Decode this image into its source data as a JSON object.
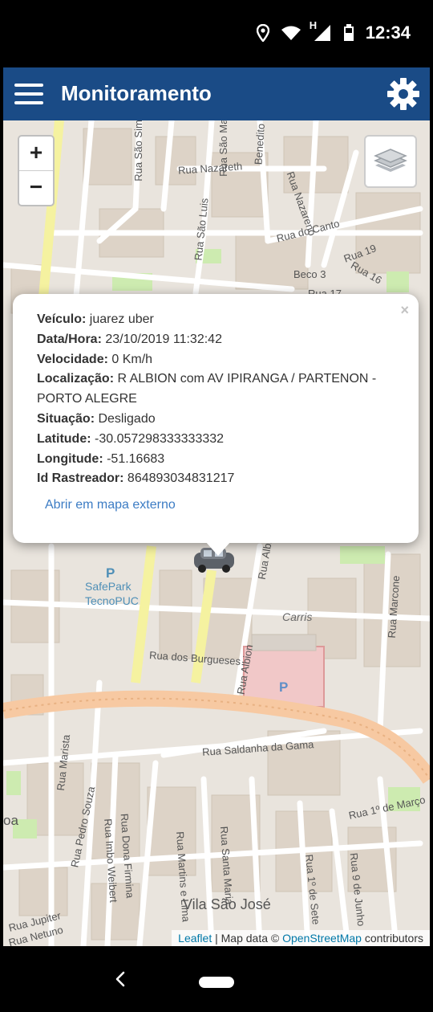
{
  "status_bar": {
    "time": "12:34",
    "network_label": "H"
  },
  "app_bar": {
    "title": "Monitoramento"
  },
  "map": {
    "labels": {
      "rua_nazareth": "Rua Nazareth",
      "rua_do_canto": "Rua do Canto",
      "rua_nazareno": "Rua Nazareno",
      "beco_3": "Beco 3",
      "rua_19": "Rua 19",
      "rua_16": "Rua 16",
      "rua_17": "Rua 17",
      "rua_sao_luis": "Rua São Luis",
      "rua_sao_simao": "Rua São Sim",
      "rua_sao_manoel": "Rua São Manoel",
      "rua_benedito": "Benedito",
      "safepark": "SafePark",
      "tecnopuc": "TecnoPUC",
      "carris": "Carris",
      "rua_albion_top": "Rua Albi",
      "rua_albion": "Rua Albion",
      "rua_dos_burgueses": "Rua dos Burgueses",
      "rua_marcone": "Rua Marcone",
      "rua_saldanha": "Rua Saldanha da Gama",
      "rua_marista": "Rua Marista",
      "rua_pedro_souza": "Rua Pedro Souza",
      "rua_imbo_weibert": "Rua Imbo Weibert",
      "rua_dona_firmina": "Rua Dona Firmina",
      "rua_santa_maria": "Rua Santa Maria",
      "rua_martins": "Rua Martins e Lima",
      "rua_1_marco": "Rua 1º de Março",
      "rua_1_sete": "Rua 1º de Sete",
      "rua_9_junho": "Rua 9 de Junho",
      "rua_jupiter": "Rua Jupiter",
      "rua_netuno": "Rua Netuno",
      "vila_sao_jose": "Vila São José",
      "oa": "oa"
    },
    "attribution": {
      "leaflet": "Leaflet",
      "sep": " | Map data © ",
      "osm": "OpenStreetMap",
      "contributors": " contributors"
    }
  },
  "popup": {
    "vehicle_label": "Veículo:",
    "vehicle_value": " juarez uber",
    "datetime_label": "Data/Hora:",
    "datetime_value": " 23/10/2019 11:32:42",
    "speed_label": "Velocidade:",
    "speed_value": " 0 Km/h",
    "location_label": "Localização:",
    "location_value": " R ALBION com AV IPIRANGA / PARTENON - PORTO ALEGRE",
    "status_label": "Situação:",
    "status_value": " Desligado",
    "latitude_label": "Latitude:",
    "latitude_value": " -30.057298333333332",
    "longitude_label": "Longitude:",
    "longitude_value": " -51.16683",
    "tracker_label": "Id Rastreador:",
    "tracker_value": " 864893034831217",
    "external_link": "Abrir em mapa externo",
    "close": "×"
  },
  "zoom": {
    "in": "+",
    "out": "−"
  },
  "icons": {
    "location": "location-pin-icon",
    "wifi": "wifi-icon",
    "signal": "signal-icon",
    "battery": "battery-icon",
    "menu": "hamburger-menu-icon",
    "settings": "gear-icon",
    "layers": "layers-icon",
    "vehicle": "car-marker-icon",
    "parking": "parking-icon",
    "back": "back-icon",
    "home": "home-pill"
  },
  "colors": {
    "app_bar": "#1a4b86",
    "map_base": "#e9e4dd",
    "main_road": "#f7c9a2",
    "yellow_road": "#f5f2a0",
    "park": "#cdebb0",
    "link": "#3c7cc4"
  }
}
